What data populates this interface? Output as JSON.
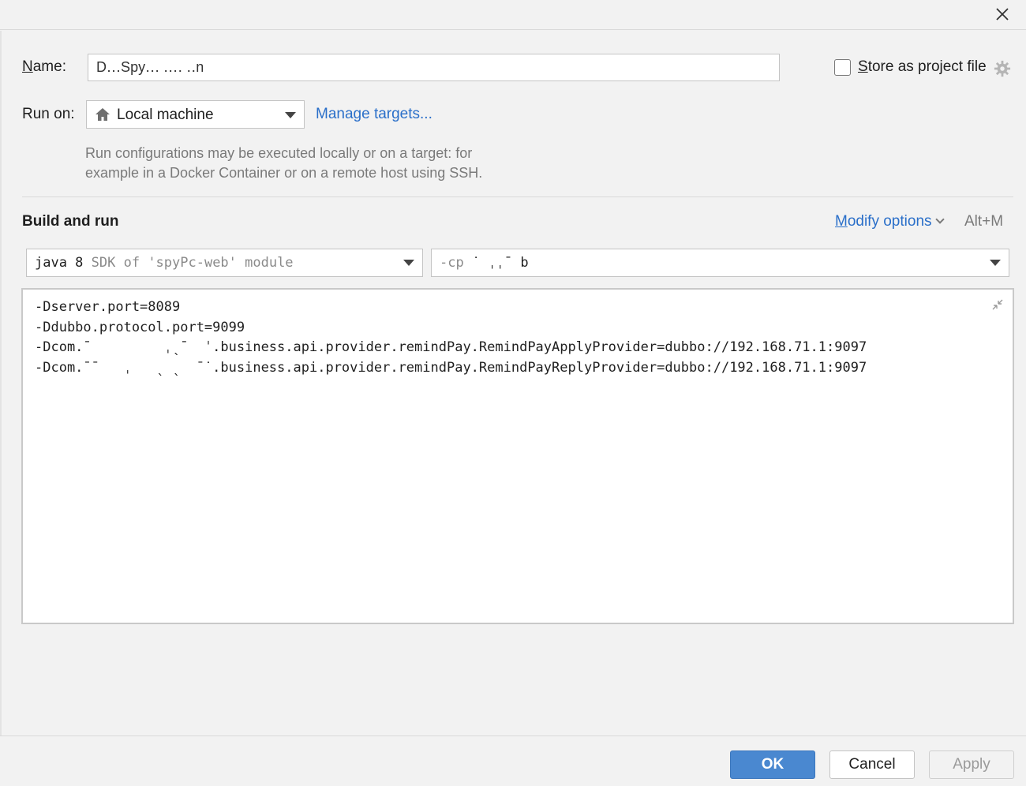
{
  "dialog": {
    "close_icon": "close-icon"
  },
  "name_field": {
    "label_prefix": "N",
    "label_rest": "ame:",
    "value": "D․․․Spy․․․ ․․․․ ․․n"
  },
  "store_as_project": {
    "label_prefix": "S",
    "label_rest": "tore as project file",
    "checked": false,
    "icon": "gear-icon"
  },
  "run_on": {
    "label": "Run on:",
    "selected": "Local machine",
    "icon": "home-icon",
    "manage_link": "Manage targets...",
    "hint_line1": "Run configurations may be executed locally or on a target: for",
    "hint_line2": "example in a Docker Container or on a remote host using SSH."
  },
  "build_and_run": {
    "title": "Build and run",
    "modify_prefix": "M",
    "modify_rest": "odify options",
    "shortcut": "Alt+M",
    "sdk_main": "java 8",
    "sdk_sub": "SDK of 'spyPc-web' module",
    "cp_prefix": "-cp",
    "cp_value": "  ˙ ˌˌˉ      b",
    "vm_options": "-Dserver.port=8089\n-Ddubbo.protocol.port=9099\n-Dcom.ˉ         ˌˎˉ  ˈ.business.api.provider.remindPay.RemindPayApplyProvider=dubbo://192.168.71.1:9097\n-Dcom.ˉˉ   ˌ   ˎ ˎ  ˉ˙.business.api.provider.remindPay.RemindPayReplyProvider=dubbo://192.168.71.1:9097"
  },
  "footer": {
    "ok": "OK",
    "cancel": "Cancel",
    "apply": "Apply"
  },
  "colors": {
    "accent": "#4a88d0",
    "link": "#2a6fc9",
    "background": "#f2f2f2"
  }
}
